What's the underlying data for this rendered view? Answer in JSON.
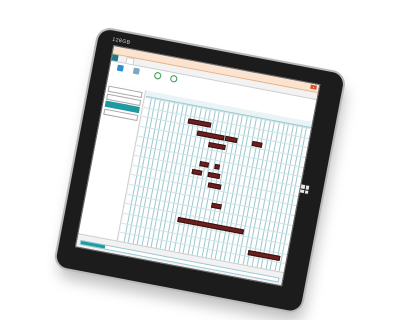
{
  "device": {
    "bezel_label": "128GB"
  },
  "window": {
    "accent_color": "#1f9aa0",
    "bar_color": "#6b1f1f"
  },
  "ribbon": {
    "tabs": [
      {
        "label": ""
      },
      {
        "label": ""
      }
    ],
    "buttons": [
      {
        "icon": "calendar-icon",
        "label": ""
      },
      {
        "icon": "document-icon",
        "label": ""
      },
      {
        "icon": "refresh-icon",
        "label": ""
      },
      {
        "icon": "refresh-icon",
        "label": ""
      }
    ]
  },
  "left_panel": {
    "fields": [
      {
        "label": "",
        "value": ""
      },
      {
        "label": "",
        "value": ""
      },
      {
        "label": "",
        "value": ""
      }
    ]
  },
  "gantt": {
    "row_count": 15,
    "column_count": 36,
    "bars": [
      {
        "row": 1,
        "start": 0.27,
        "end": 0.4
      },
      {
        "row": 2,
        "start": 0.34,
        "end": 0.49
      },
      {
        "row": 2,
        "start": 0.51,
        "end": 0.57
      },
      {
        "row": 2,
        "start": 0.67,
        "end": 0.72
      },
      {
        "row": 3,
        "start": 0.42,
        "end": 0.51
      },
      {
        "row": 5,
        "start": 0.39,
        "end": 0.43
      },
      {
        "row": 5,
        "start": 0.48,
        "end": 0.5
      },
      {
        "row": 6,
        "start": 0.35,
        "end": 0.4
      },
      {
        "row": 6,
        "start": 0.45,
        "end": 0.51
      },
      {
        "row": 7,
        "start": 0.46,
        "end": 0.53
      },
      {
        "row": 9,
        "start": 0.5,
        "end": 0.55
      },
      {
        "row": 11,
        "start": 0.32,
        "end": 0.71
      },
      {
        "row": 13,
        "start": 0.77,
        "end": 0.95
      }
    ]
  },
  "status": {
    "text": "",
    "date_range_fraction": 0.12
  }
}
